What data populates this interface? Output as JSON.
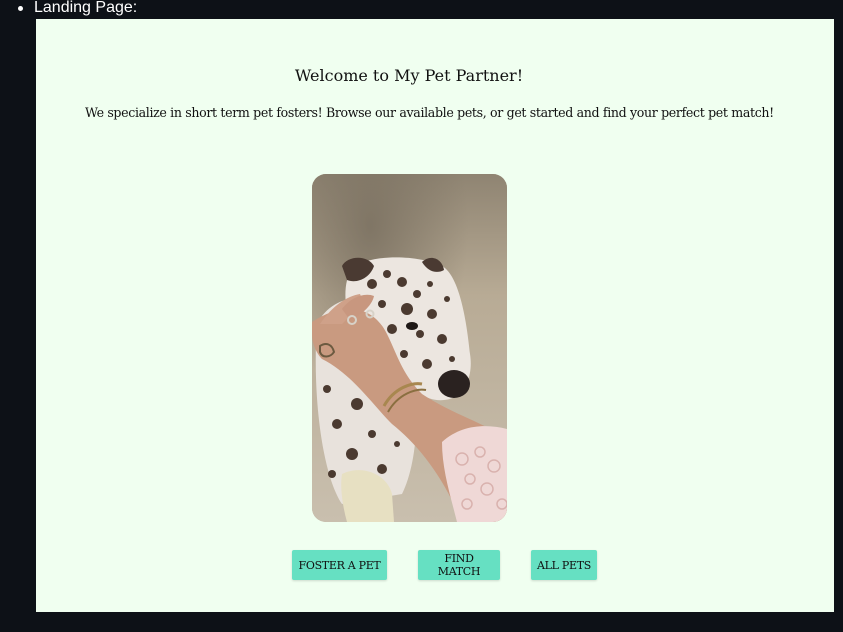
{
  "outer": {
    "bullet_label": "Landing Page:"
  },
  "page": {
    "title": "Welcome to My Pet Partner!",
    "tagline": "We specialize in short term pet fosters! Browse our available pets, or get started and find your perfect pet match!",
    "hero_image": "dog-photo"
  },
  "buttons": {
    "foster": "FOSTER A PET",
    "match": "FIND MATCH",
    "all": "ALL PETS"
  },
  "colors": {
    "page_background": "#f0fff0",
    "button_background": "#66e0c2",
    "outer_background": "#0d1117"
  }
}
